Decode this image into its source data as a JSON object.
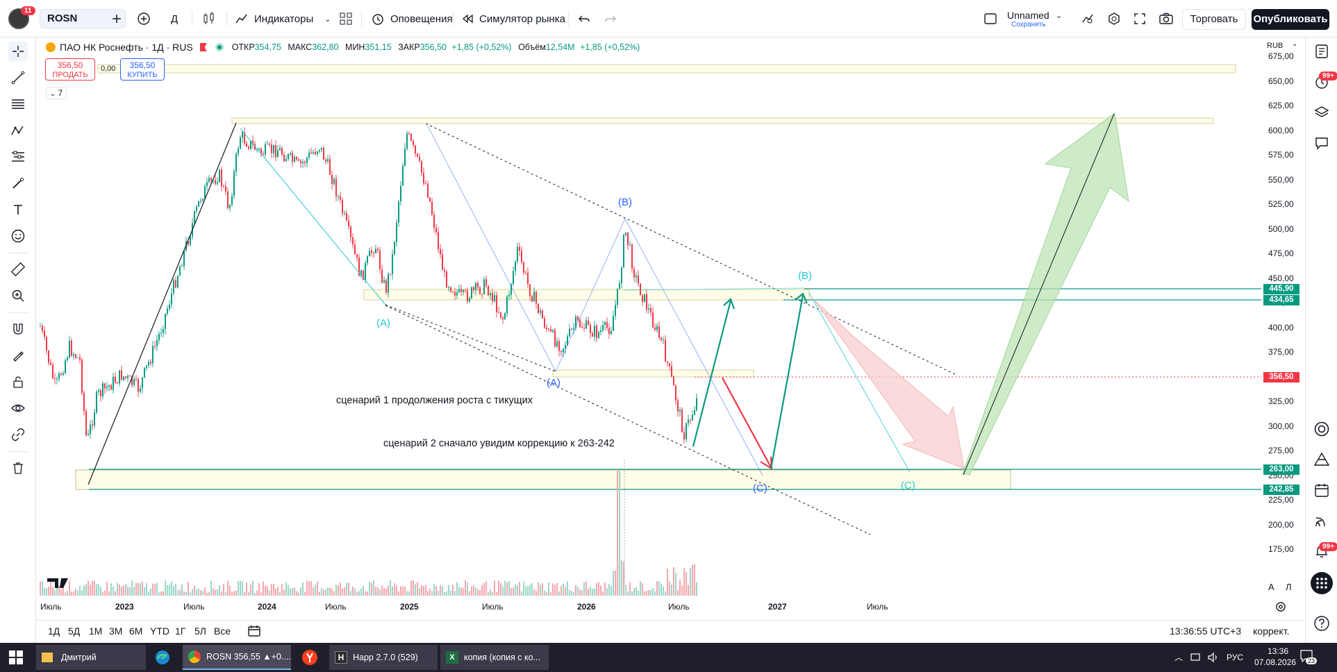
{
  "topbar": {
    "notif_count": "11",
    "symbol": "ROSN",
    "interval": "Д",
    "indicators": "Индикаторы",
    "alerts": "Оповещения",
    "replay": "Симулятор рынка",
    "layout_name": "Unnamed",
    "layout_status": "Сохранить",
    "trade": "Торговать",
    "publish": "Опубликовать"
  },
  "legend": {
    "title": "ПАО НК Роснефть · 1Д · RUS",
    "open_label": "ОТКР",
    "open": "354,75",
    "high_label": "МАКС",
    "high": "362,80",
    "low_label": "МИН",
    "low": "351,15",
    "close_label": "ЗАКР",
    "close": "356,50",
    "change": "+1,85 (+0,52%)",
    "volume_label": "Объём",
    "volume": "12,54M",
    "vol_change": "+1,85 (+0,52%)",
    "sell_price": "356,50",
    "sell_label": "ПРОДАТЬ",
    "spread": "0,00",
    "buy_price": "356,50",
    "buy_label": "КУПИТЬ",
    "indicators_collapsed": "7"
  },
  "yaxis": {
    "currency": "RUB",
    "labels": [
      "675,00",
      "650,00",
      "625,00",
      "600,00",
      "575,00",
      "550,00",
      "525,00",
      "500,00",
      "475,00",
      "450,00",
      "425,00",
      "400,00",
      "375,00",
      "350,00",
      "325,00",
      "300,00",
      "275,00",
      "250,00",
      "225,00",
      "200,00",
      "175,00"
    ],
    "tags": [
      {
        "value": "445,90",
        "color": "#089981"
      },
      {
        "value": "434,65",
        "color": "#089981"
      },
      {
        "value": "356,50",
        "color": "#f23645"
      },
      {
        "value": "263,00",
        "color": "#089981"
      },
      {
        "value": "242,85",
        "color": "#089981"
      }
    ],
    "auto": "А",
    "log": "Л"
  },
  "xaxis": {
    "labels": [
      {
        "text": "Июль",
        "bold": false
      },
      {
        "text": "2023",
        "bold": true
      },
      {
        "text": "Июль",
        "bold": false
      },
      {
        "text": "2024",
        "bold": true
      },
      {
        "text": "Июль",
        "bold": false
      },
      {
        "text": "2025",
        "bold": true
      },
      {
        "text": "Июль",
        "bold": false
      },
      {
        "text": "2026",
        "bold": true
      },
      {
        "text": "Июль",
        "bold": false
      },
      {
        "text": "2027",
        "bold": true
      },
      {
        "text": "Июль",
        "bold": false
      }
    ]
  },
  "annotations": {
    "scenario1": "сценарий 1 продолжения роста с тикущих",
    "scenario2": "сценарий 2 сначало увидим коррекцию к 263-242",
    "waves": [
      {
        "text": "(A)",
        "color": "#26c6da"
      },
      {
        "text": "(B)",
        "color": "#2962ff"
      },
      {
        "text": "(A)",
        "color": "#2962ff"
      },
      {
        "text": "(B)",
        "color": "#26c6da"
      },
      {
        "text": "(C)",
        "color": "#2962ff"
      },
      {
        "text": "(C)",
        "color": "#26c6da"
      }
    ]
  },
  "bottombar": {
    "timeframes": [
      "1Д",
      "5Д",
      "1М",
      "3М",
      "6М",
      "YTD",
      "1Г",
      "5Л",
      "Все"
    ],
    "time": "13:36:55 UTC+3",
    "adjust": "коррект."
  },
  "taskbar": {
    "items": [
      "Дмитрий",
      "ROSN 356,55 ▲+0....",
      "Happ 2.7.0 (529)",
      "копия (копия с ко..."
    ],
    "lang": "РУС",
    "clock_time": "13:36",
    "clock_date": "07.08.2026",
    "notif": "23"
  },
  "right_badges": [
    "99+",
    "99+"
  ],
  "colors": {
    "up": "#089981",
    "down": "#f23645",
    "accent": "#2962ff",
    "zone": "#fffde7"
  }
}
